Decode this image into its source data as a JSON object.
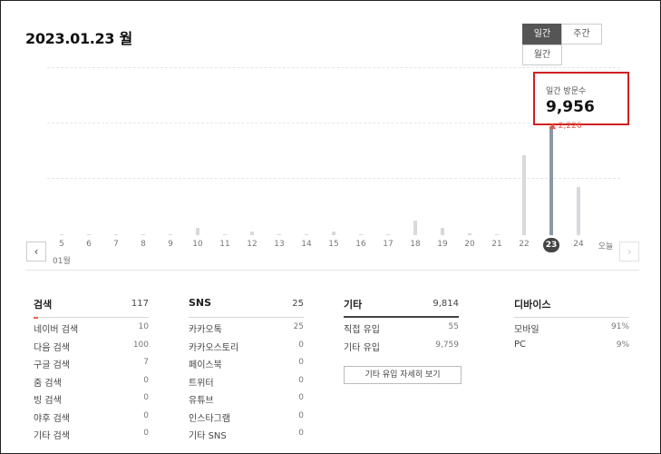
{
  "date_title": "2023.01.23 월",
  "period_toggle": {
    "daily": "일간",
    "weekly": "주간",
    "monthly": "월간"
  },
  "tooltip": {
    "label": "일간 방문수",
    "value": "9,956",
    "delta": "2,226"
  },
  "chart_data": {
    "type": "bar",
    "month_label": "01월",
    "x": [
      "5",
      "6",
      "7",
      "8",
      "9",
      "10",
      "11",
      "12",
      "13",
      "14",
      "15",
      "16",
      "17",
      "18",
      "19",
      "20",
      "21",
      "22",
      "23",
      "24"
    ],
    "today_label": "오늘",
    "values": [
      0,
      0,
      0,
      0,
      0,
      6,
      0,
      3,
      0,
      0,
      3,
      0,
      0,
      12,
      6,
      2,
      0,
      73,
      9956,
      43
    ],
    "relative_height": [
      0.005,
      0.005,
      0.005,
      0.01,
      0.01,
      0.065,
      0.01,
      0.03,
      0.005,
      0.005,
      0.03,
      0.005,
      0.005,
      0.135,
      0.065,
      0.02,
      0.005,
      0.73,
      1.0,
      0.445
    ],
    "active_index": 18,
    "active_color": "#8b98a8",
    "bar_color": "#d7d9dc"
  },
  "nav": {
    "prev": "‹",
    "next": "›"
  },
  "stats": {
    "search": {
      "title": "검색",
      "total": "117",
      "rows": [
        {
          "label": "네이버 검색",
          "value": "10"
        },
        {
          "label": "다음 검색",
          "value": "100"
        },
        {
          "label": "구글 검색",
          "value": "7"
        },
        {
          "label": "줌 검색",
          "value": "0"
        },
        {
          "label": "빙 검색",
          "value": "0"
        },
        {
          "label": "야후 검색",
          "value": "0"
        },
        {
          "label": "기타 검색",
          "value": "0"
        }
      ]
    },
    "sns": {
      "title": "SNS",
      "total": "25",
      "rows": [
        {
          "label": "카카오톡",
          "value": "25"
        },
        {
          "label": "카카오스토리",
          "value": "0"
        },
        {
          "label": "페이스북",
          "value": "0"
        },
        {
          "label": "트위터",
          "value": "0"
        },
        {
          "label": "유튜브",
          "value": "0"
        },
        {
          "label": "인스타그램",
          "value": "0"
        },
        {
          "label": "기타 SNS",
          "value": "0"
        }
      ]
    },
    "etc": {
      "title": "기타",
      "total": "9,814",
      "rows": [
        {
          "label": "직접 유입",
          "value": "55"
        },
        {
          "label": "기타 유입",
          "value": "9,759"
        }
      ],
      "detail_button": "기타 유입 자세히 보기"
    },
    "device": {
      "title": "디바이스",
      "rows": [
        {
          "label": "모바일",
          "value": "91%"
        },
        {
          "label": "PC",
          "value": "9%"
        }
      ]
    }
  }
}
